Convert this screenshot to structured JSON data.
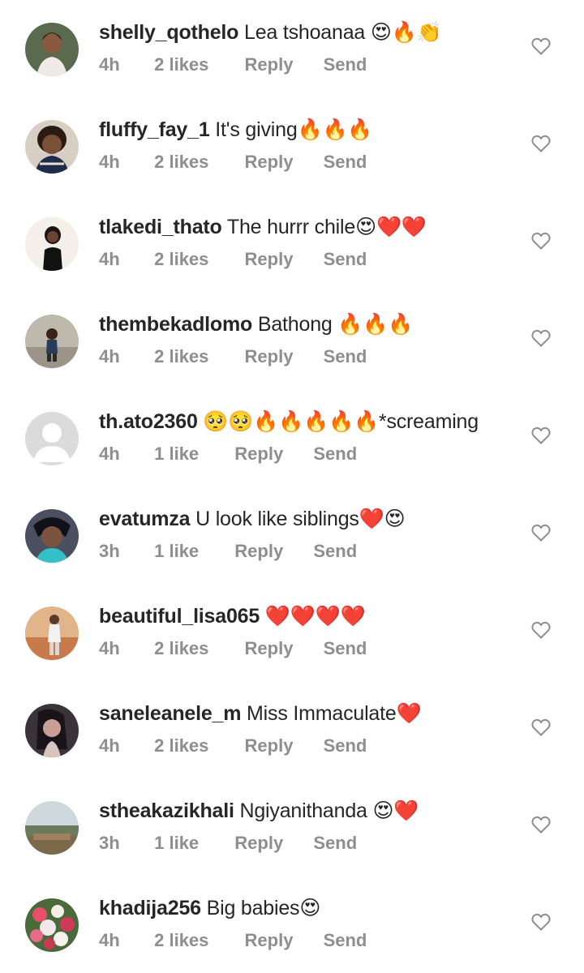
{
  "comments": [
    {
      "username": "shelly_qothelo",
      "text": "Lea tshoanaa 😍🔥👏",
      "time": "4h",
      "likes": "2 likes",
      "reply": "Reply",
      "send": "Send",
      "avatar_color": "#c9a48a"
    },
    {
      "username": "fluffy_fay_1",
      "text": "It's giving🔥🔥🔥",
      "time": "4h",
      "likes": "2 likes",
      "reply": "Reply",
      "send": "Send",
      "avatar_color": "#6b4a3a"
    },
    {
      "username": "tlakedi_thato",
      "text": "The hurrr chile😍❤️❤️",
      "time": "4h",
      "likes": "2 likes",
      "reply": "Reply",
      "send": "Send",
      "avatar_color": "#efe6e0"
    },
    {
      "username": "thembekadlomo",
      "text": "Bathong 🔥🔥🔥",
      "time": "4h",
      "likes": "2 likes",
      "reply": "Reply",
      "send": "Send",
      "avatar_color": "#c8c2b8"
    },
    {
      "username": "th.ato2360",
      "text": "🥺🥺🔥🔥🔥🔥🔥*screaming",
      "time": "4h",
      "likes": "1 like",
      "reply": "Reply",
      "send": "Send",
      "avatar_color": "#dbdbdb"
    },
    {
      "username": "evatumza",
      "text": "U look like siblings❤️😍",
      "time": "3h",
      "likes": "1 like",
      "reply": "Reply",
      "send": "Send",
      "avatar_color": "#3a3f4a"
    },
    {
      "username": "beautiful_lisa065",
      "text": "❤️❤️❤️❤️",
      "time": "4h",
      "likes": "2 likes",
      "reply": "Reply",
      "send": "Send",
      "avatar_color": "#d98a5a"
    },
    {
      "username": "saneleanele_m",
      "text": "Miss Immaculate❤️",
      "time": "4h",
      "likes": "2 likes",
      "reply": "Reply",
      "send": "Send",
      "avatar_color": "#2e2a30"
    },
    {
      "username": "stheakazikhali",
      "text": "Ngiyanithanda 😍❤️",
      "time": "3h",
      "likes": "1 like",
      "reply": "Reply",
      "send": "Send",
      "avatar_color": "#7a8a6a"
    },
    {
      "username": "khadija256",
      "text": "Big babies😍",
      "time": "4h",
      "likes": "2 likes",
      "reply": "Reply",
      "send": "Send",
      "avatar_color": "#c4506a"
    }
  ],
  "icons": {
    "like": "heart-outline-icon",
    "default_avatar": "user-silhouette-icon"
  },
  "colors": {
    "text_primary": "#262626",
    "text_secondary": "#8e8e8e",
    "background": "#ffffff"
  }
}
